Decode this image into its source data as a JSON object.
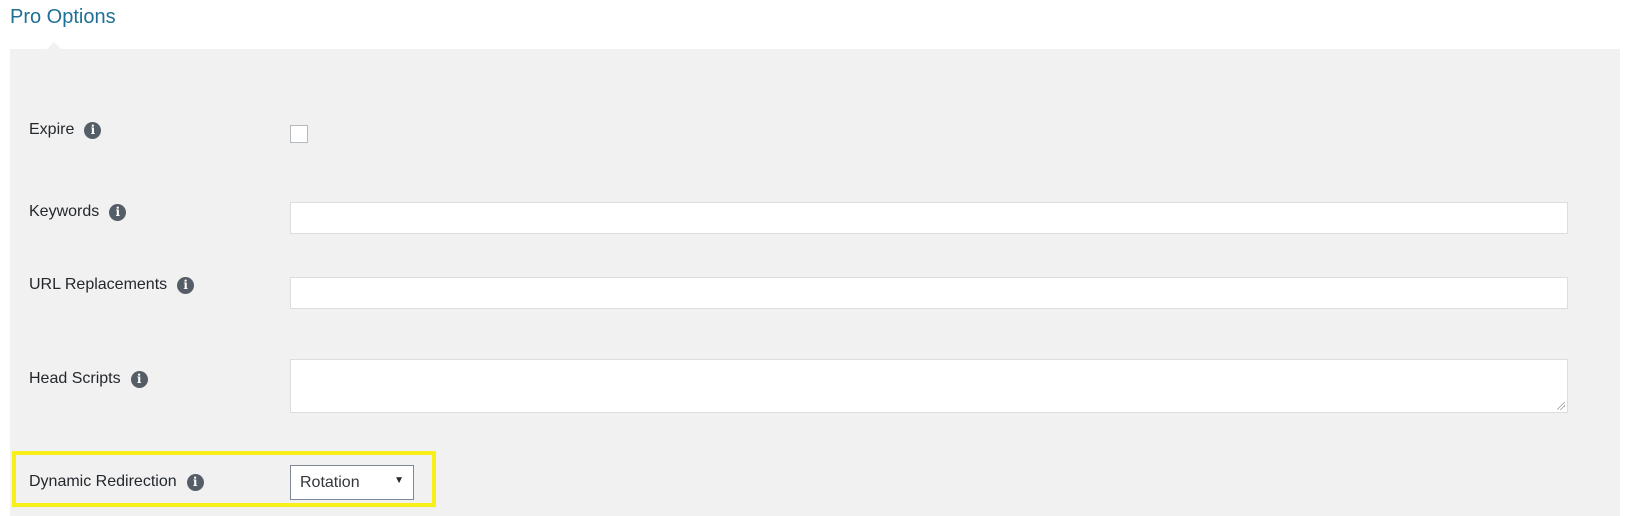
{
  "section": {
    "title": "Pro Options"
  },
  "fields": {
    "expire": {
      "label": "Expire",
      "icon": "info-icon",
      "checked": false
    },
    "keywords": {
      "label": "Keywords",
      "icon": "info-icon",
      "value": ""
    },
    "url_replacements": {
      "label": "URL Replacements",
      "icon": "info-icon",
      "value": ""
    },
    "head_scripts": {
      "label": "Head Scripts",
      "icon": "info-icon",
      "value": ""
    },
    "dynamic_redirection": {
      "label": "Dynamic Redirection",
      "icon": "info-icon",
      "selected": "Rotation"
    }
  },
  "info_glyph": "i",
  "colors": {
    "title": "#1f6f96",
    "panel_bg": "#f1f1f1",
    "highlight": "#f7ee1a",
    "icon_bg": "#555d66"
  }
}
